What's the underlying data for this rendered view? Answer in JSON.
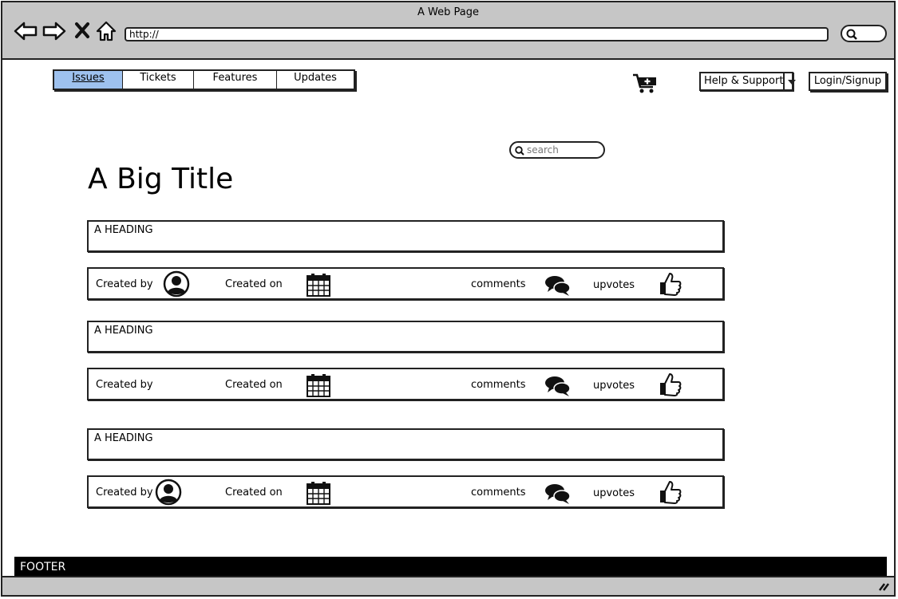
{
  "window": {
    "title": "A Web Page"
  },
  "browser": {
    "address": "http://",
    "icons": [
      "back-arrow-icon",
      "forward-arrow-icon",
      "stop-icon",
      "home-icon",
      "search-icon"
    ]
  },
  "nav": {
    "tabs": [
      {
        "label": "Issues",
        "active": true
      },
      {
        "label": "Tickets",
        "active": false
      },
      {
        "label": "Features",
        "active": false
      },
      {
        "label": "Updates",
        "active": false
      }
    ],
    "cart_icon": "cart-add-icon",
    "help_label": "Help & Support",
    "login_label": "Login/Signup"
  },
  "search": {
    "placeholder": "search"
  },
  "page": {
    "title": "A Big Title"
  },
  "issues": [
    {
      "heading": "A HEADING",
      "created_by_label": "Created by",
      "created_on_label": "Created on",
      "comments_label": "comments",
      "upvotes_label": "upvotes",
      "has_avatar": true
    },
    {
      "heading": "A HEADING",
      "created_by_label": "Created by",
      "created_on_label": "Created on",
      "comments_label": "comments",
      "upvotes_label": "upvotes",
      "has_avatar": false
    },
    {
      "heading": "A HEADING",
      "created_by_label": "Created by",
      "created_on_label": "Created on",
      "comments_label": "comments",
      "upvotes_label": "upvotes",
      "has_avatar": true
    }
  ],
  "footer": {
    "label": "FOOTER"
  },
  "colors": {
    "active_tab": "#9ec1ee",
    "chrome": "#c6c6c6",
    "footer": "#000000"
  }
}
